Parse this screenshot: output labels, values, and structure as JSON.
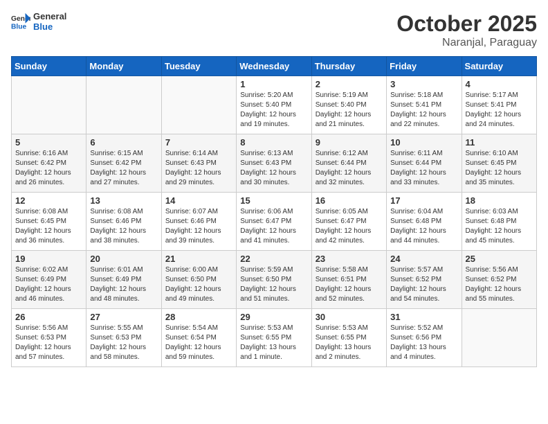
{
  "header": {
    "logo_general": "General",
    "logo_blue": "Blue",
    "month_title": "October 2025",
    "subtitle": "Naranjal, Paraguay"
  },
  "weekdays": [
    "Sunday",
    "Monday",
    "Tuesday",
    "Wednesday",
    "Thursday",
    "Friday",
    "Saturday"
  ],
  "weeks": [
    [
      {
        "day": "",
        "info": ""
      },
      {
        "day": "",
        "info": ""
      },
      {
        "day": "",
        "info": ""
      },
      {
        "day": "1",
        "info": "Sunrise: 5:20 AM\nSunset: 5:40 PM\nDaylight: 12 hours\nand 19 minutes."
      },
      {
        "day": "2",
        "info": "Sunrise: 5:19 AM\nSunset: 5:40 PM\nDaylight: 12 hours\nand 21 minutes."
      },
      {
        "day": "3",
        "info": "Sunrise: 5:18 AM\nSunset: 5:41 PM\nDaylight: 12 hours\nand 22 minutes."
      },
      {
        "day": "4",
        "info": "Sunrise: 5:17 AM\nSunset: 5:41 PM\nDaylight: 12 hours\nand 24 minutes."
      }
    ],
    [
      {
        "day": "5",
        "info": "Sunrise: 6:16 AM\nSunset: 6:42 PM\nDaylight: 12 hours\nand 26 minutes."
      },
      {
        "day": "6",
        "info": "Sunrise: 6:15 AM\nSunset: 6:42 PM\nDaylight: 12 hours\nand 27 minutes."
      },
      {
        "day": "7",
        "info": "Sunrise: 6:14 AM\nSunset: 6:43 PM\nDaylight: 12 hours\nand 29 minutes."
      },
      {
        "day": "8",
        "info": "Sunrise: 6:13 AM\nSunset: 6:43 PM\nDaylight: 12 hours\nand 30 minutes."
      },
      {
        "day": "9",
        "info": "Sunrise: 6:12 AM\nSunset: 6:44 PM\nDaylight: 12 hours\nand 32 minutes."
      },
      {
        "day": "10",
        "info": "Sunrise: 6:11 AM\nSunset: 6:44 PM\nDaylight: 12 hours\nand 33 minutes."
      },
      {
        "day": "11",
        "info": "Sunrise: 6:10 AM\nSunset: 6:45 PM\nDaylight: 12 hours\nand 35 minutes."
      }
    ],
    [
      {
        "day": "12",
        "info": "Sunrise: 6:08 AM\nSunset: 6:45 PM\nDaylight: 12 hours\nand 36 minutes."
      },
      {
        "day": "13",
        "info": "Sunrise: 6:08 AM\nSunset: 6:46 PM\nDaylight: 12 hours\nand 38 minutes."
      },
      {
        "day": "14",
        "info": "Sunrise: 6:07 AM\nSunset: 6:46 PM\nDaylight: 12 hours\nand 39 minutes."
      },
      {
        "day": "15",
        "info": "Sunrise: 6:06 AM\nSunset: 6:47 PM\nDaylight: 12 hours\nand 41 minutes."
      },
      {
        "day": "16",
        "info": "Sunrise: 6:05 AM\nSunset: 6:47 PM\nDaylight: 12 hours\nand 42 minutes."
      },
      {
        "day": "17",
        "info": "Sunrise: 6:04 AM\nSunset: 6:48 PM\nDaylight: 12 hours\nand 44 minutes."
      },
      {
        "day": "18",
        "info": "Sunrise: 6:03 AM\nSunset: 6:48 PM\nDaylight: 12 hours\nand 45 minutes."
      }
    ],
    [
      {
        "day": "19",
        "info": "Sunrise: 6:02 AM\nSunset: 6:49 PM\nDaylight: 12 hours\nand 46 minutes."
      },
      {
        "day": "20",
        "info": "Sunrise: 6:01 AM\nSunset: 6:49 PM\nDaylight: 12 hours\nand 48 minutes."
      },
      {
        "day": "21",
        "info": "Sunrise: 6:00 AM\nSunset: 6:50 PM\nDaylight: 12 hours\nand 49 minutes."
      },
      {
        "day": "22",
        "info": "Sunrise: 5:59 AM\nSunset: 6:50 PM\nDaylight: 12 hours\nand 51 minutes."
      },
      {
        "day": "23",
        "info": "Sunrise: 5:58 AM\nSunset: 6:51 PM\nDaylight: 12 hours\nand 52 minutes."
      },
      {
        "day": "24",
        "info": "Sunrise: 5:57 AM\nSunset: 6:52 PM\nDaylight: 12 hours\nand 54 minutes."
      },
      {
        "day": "25",
        "info": "Sunrise: 5:56 AM\nSunset: 6:52 PM\nDaylight: 12 hours\nand 55 minutes."
      }
    ],
    [
      {
        "day": "26",
        "info": "Sunrise: 5:56 AM\nSunset: 6:53 PM\nDaylight: 12 hours\nand 57 minutes."
      },
      {
        "day": "27",
        "info": "Sunrise: 5:55 AM\nSunset: 6:53 PM\nDaylight: 12 hours\nand 58 minutes."
      },
      {
        "day": "28",
        "info": "Sunrise: 5:54 AM\nSunset: 6:54 PM\nDaylight: 12 hours\nand 59 minutes."
      },
      {
        "day": "29",
        "info": "Sunrise: 5:53 AM\nSunset: 6:55 PM\nDaylight: 13 hours\nand 1 minute."
      },
      {
        "day": "30",
        "info": "Sunrise: 5:53 AM\nSunset: 6:55 PM\nDaylight: 13 hours\nand 2 minutes."
      },
      {
        "day": "31",
        "info": "Sunrise: 5:52 AM\nSunset: 6:56 PM\nDaylight: 13 hours\nand 4 minutes."
      },
      {
        "day": "",
        "info": ""
      }
    ]
  ]
}
